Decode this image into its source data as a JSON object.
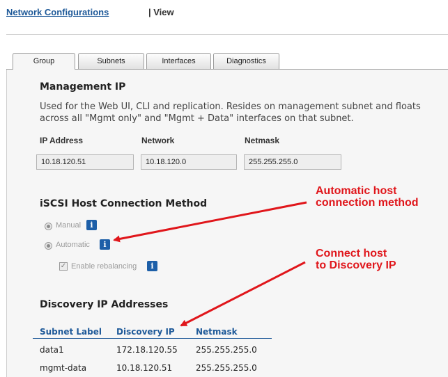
{
  "header": {
    "link": "Network Configurations",
    "view": "| View"
  },
  "tabs": [
    {
      "label": "Group",
      "active": true
    },
    {
      "label": "Subnets",
      "active": false
    },
    {
      "label": "Interfaces",
      "active": false
    },
    {
      "label": "Diagnostics",
      "active": false
    }
  ],
  "management": {
    "title": "Management IP",
    "desc_line1": "Used for the Web UI, CLI and replication. Resides on management subnet and floats",
    "desc_line2": "across all \"Mgmt only\" and \"Mgmt + Data\" interfaces on that subnet.",
    "ip_label": "IP Address",
    "ip_value": "10.18.120.51",
    "network_label": "Network",
    "network_value": "10.18.120.0",
    "netmask_label": "Netmask",
    "netmask_value": "255.255.255.0"
  },
  "iscsi": {
    "title": "iSCSI Host Connection Method",
    "manual_label": "Manual",
    "automatic_label": "Automatic",
    "selected": "Automatic",
    "rebalance_label": "Enable rebalancing",
    "rebalance_checked": true
  },
  "discovery": {
    "title": "Discovery IP Addresses",
    "columns": [
      "Subnet Label",
      "Discovery IP",
      "Netmask"
    ],
    "rows": [
      [
        "data1",
        "172.18.120.55",
        "255.255.255.0"
      ],
      [
        "mgmt-data",
        "10.18.120.51",
        "255.255.255.0"
      ]
    ]
  },
  "annotations": {
    "a1_line1": "Automatic host",
    "a1_line2": "connection method",
    "a2_line1": "Connect host",
    "a2_line2": "to Discovery IP"
  },
  "colors": {
    "link": "#1f5a99",
    "annotation": "#e0161b",
    "info_icon": "#1d5fa8"
  }
}
